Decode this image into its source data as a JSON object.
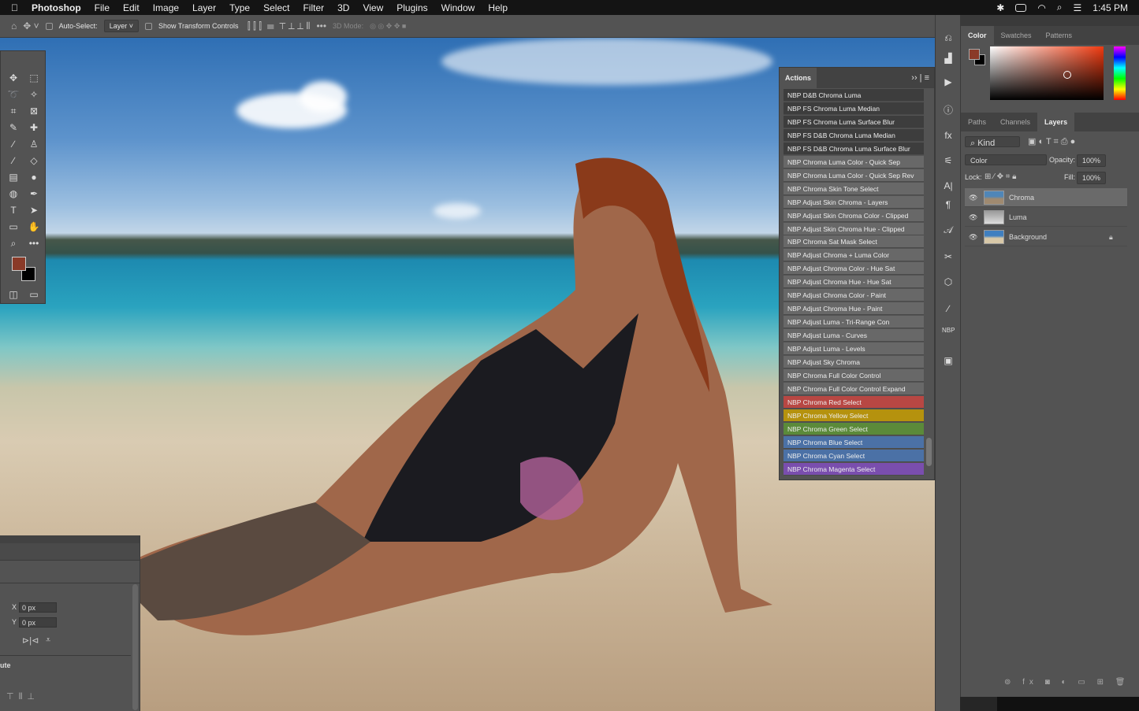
{
  "menubar": {
    "app": "Photoshop",
    "items": [
      "File",
      "Edit",
      "Image",
      "Layer",
      "Type",
      "Select",
      "Filter",
      "3D",
      "View",
      "Plugins",
      "Window",
      "Help"
    ],
    "clock": "1:45 PM"
  },
  "options": {
    "auto_select_label": "Auto-Select:",
    "auto_select_value": "Layer",
    "show_transform": "Show Transform Controls",
    "mode_3d": "3D Mode:"
  },
  "actions": {
    "title": "Actions",
    "items": [
      {
        "label": "NBP D&B Chroma Luma",
        "color": "#3d3d3d"
      },
      {
        "label": "NBP FS Chroma Luma Median",
        "color": "#3d3d3d"
      },
      {
        "label": "NBP FS Chroma Luma Surface Blur",
        "color": "#3d3d3d"
      },
      {
        "label": "NBP FS D&B Chroma Luma Median",
        "color": "#3d3d3d"
      },
      {
        "label": "NBP FS D&B Chroma Luma Surface Blur",
        "color": "#3d3d3d"
      },
      {
        "label": "NBP Chroma Luma Color - Quick Sep",
        "color": "#686868"
      },
      {
        "label": "NBP Chroma Luma Color - Quick Sep Rev",
        "color": "#686868"
      },
      {
        "label": "NBP Chroma Skin Tone Select",
        "color": "#686868"
      },
      {
        "label": "NBP Adjust Skin Chroma - Layers",
        "color": "#686868"
      },
      {
        "label": "NBP Adjust Skin Chroma Color - Clipped",
        "color": "#686868"
      },
      {
        "label": "NBP Adjust Skin Chroma Hue - Clipped",
        "color": "#686868"
      },
      {
        "label": "NBP Chroma Sat Mask Select",
        "color": "#686868"
      },
      {
        "label": "NBP Adjust Chroma + Luma Color",
        "color": "#686868"
      },
      {
        "label": "NBP Adjust Chroma Color - Hue Sat",
        "color": "#686868"
      },
      {
        "label": "NBP Adjust Chroma Hue - Hue Sat",
        "color": "#686868"
      },
      {
        "label": "NBP Adjust Chroma Color - Paint",
        "color": "#686868"
      },
      {
        "label": "NBP Adjust Chroma Hue - Paint",
        "color": "#686868"
      },
      {
        "label": "NBP Adjust Luma - Tri-Range Con",
        "color": "#686868"
      },
      {
        "label": "NBP Adjust Luma - Curves",
        "color": "#686868"
      },
      {
        "label": "NBP Adjust Luma - Levels",
        "color": "#686868"
      },
      {
        "label": "NBP Adjust Sky Chroma",
        "color": "#686868"
      },
      {
        "label": "NBP Chroma Full Color Control",
        "color": "#686868"
      },
      {
        "label": "NBP Chroma Full Color Control Expand",
        "color": "#686868"
      },
      {
        "label": "NBP Chroma Red Select",
        "color": "#b84743"
      },
      {
        "label": "NBP Chroma Yellow Select",
        "color": "#b5920e"
      },
      {
        "label": "NBP Chroma Green Select",
        "color": "#5b8a3a"
      },
      {
        "label": "NBP Chroma Blue Select",
        "color": "#4b71a6"
      },
      {
        "label": "NBP Chroma Cyan Select",
        "color": "#4b71a6"
      },
      {
        "label": "NBP Chroma Magenta Select",
        "color": "#7a4eae"
      }
    ]
  },
  "color_panel": {
    "tabs": [
      "Color",
      "Swatches",
      "Patterns"
    ],
    "foreground": "#8a3a28",
    "background": "#000000"
  },
  "layers_panel": {
    "tabs": [
      "Paths",
      "Channels",
      "Layers"
    ],
    "filter": "Kind",
    "blend_mode": "Color",
    "opacity_label": "Opacity:",
    "opacity": "100%",
    "lock_label": "Lock:",
    "fill_label": "Fill:",
    "fill": "100%",
    "layers": [
      {
        "name": "Chroma",
        "selected": true
      },
      {
        "name": "Luma",
        "selected": false
      },
      {
        "name": "Background",
        "selected": false,
        "locked": true
      }
    ]
  },
  "properties": {
    "x_label": "X",
    "x_value": "0 px",
    "y_label": "Y",
    "y_value": "0 px",
    "partial_label": "ute"
  }
}
